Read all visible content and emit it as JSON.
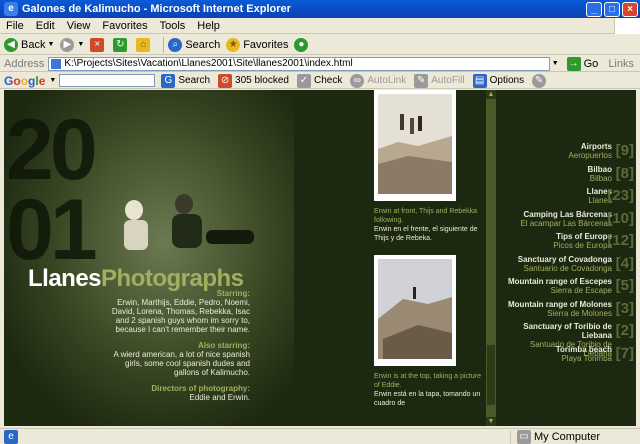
{
  "window": {
    "title": "Galones de Kalimucho - Microsoft Internet Explorer"
  },
  "menu": [
    "File",
    "Edit",
    "View",
    "Favorites",
    "Tools",
    "Help"
  ],
  "toolbar": {
    "back": "Back",
    "search": "Search",
    "favorites": "Favorites"
  },
  "address": {
    "label": "Address",
    "url": "K:\\Projects\\Sites\\Vacation\\Llanes2001\\Site\\llanes2001\\index.html",
    "go": "Go",
    "links": "Links"
  },
  "googlebar": {
    "logo": "Google",
    "search": "Search",
    "blocked": "305 blocked",
    "check": "Check",
    "autolink": "AutoLink",
    "autofill": "AutoFill",
    "options": "Options"
  },
  "page": {
    "bignum_top": "20",
    "bignum_bottom": "01",
    "headline_white": "Llanes",
    "headline_green": "Photographs",
    "starring_h": "Starring:",
    "starring": "Erwin, Marthijs, Eddie, Pedro, Noemi, David, Lorena, Thomas, Rebekka, Isac and 2 spanish guys whom im sorry to, because I can't remember their name.",
    "also_h": "Also starring:",
    "also": "A wierd american, a lot of nice spanish girls, some cool spanish dudes and gallons of Kalimucho.",
    "directors_h": "Directors of photography:",
    "directors": "Eddie and Erwin.",
    "caption1_en": "Erwin at front, Thijs and Rebekka following.",
    "caption1_es": "Erwin en el frente, el siguiente de Thijs y de Rebeka.",
    "caption2_en": "Erwin is at the top, taking a picture of Eddie.",
    "caption2_es": "Erwin está en la tapa, tomando un cuadro de"
  },
  "places": [
    {
      "en": "Airports",
      "es": "Aeropuertos",
      "count": "[9]"
    },
    {
      "en": "Bilbao",
      "es": "Bilbao",
      "count": "[8]"
    },
    {
      "en": "Llanes",
      "es": "Llanes",
      "count": "[23]"
    },
    {
      "en": "Camping Las Bárcenas",
      "es": "El acampar Las Bárcenas",
      "count": "[10]"
    },
    {
      "en": "Tips of Europe",
      "es": "Picos de Europa",
      "count": "[12]"
    },
    {
      "en": "Sanctuary of Covadonga",
      "es": "Santuario de Covadonga",
      "count": "[4]"
    },
    {
      "en": "Mountain range of Escepes",
      "es": "Sierra de Escape",
      "count": "[5]"
    },
    {
      "en": "Mountain range of Molones",
      "es": "Sierra de Molones",
      "count": "[3]"
    },
    {
      "en": "Sanctuary of Toribio de Liebana",
      "es": "Santuario de Toribio de Liebana",
      "count": "[2]"
    },
    {
      "en": "Torimba beach",
      "es": "Playa Torimba",
      "count": "[7]"
    }
  ],
  "status": {
    "zone": "My Computer"
  }
}
